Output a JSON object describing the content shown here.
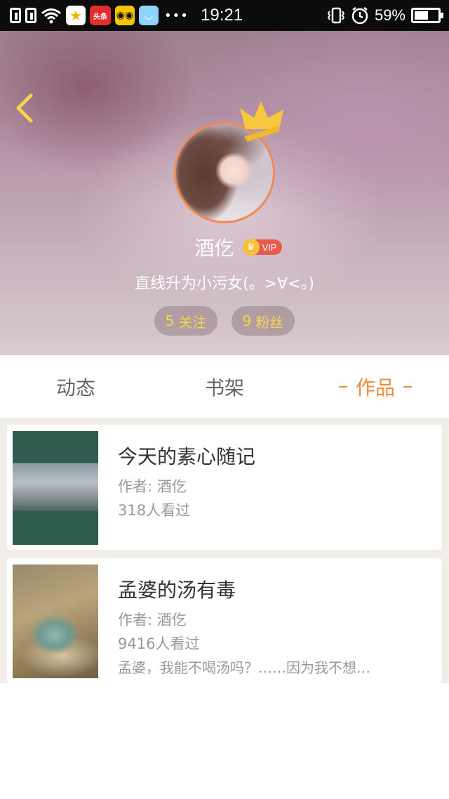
{
  "status_bar": {
    "time": "19:21",
    "battery_percent": "59%",
    "battery_level": 0.59,
    "app_toutiao_label": "头条",
    "more_dots": "•••"
  },
  "profile": {
    "username": "酒仡",
    "vip_label": "VIP",
    "bio": "直线升为小污女(。>∀<。)",
    "follow_count": "5",
    "follow_label": "关注",
    "fans_count": "9",
    "fans_label": "粉丝"
  },
  "tabs": [
    {
      "label": "动态",
      "active": false
    },
    {
      "label": "书架",
      "active": false
    },
    {
      "label": "作品",
      "active": true
    }
  ],
  "works": [
    {
      "title": "今天的素心随记",
      "author": "作者: 酒仡",
      "views": "318人看过",
      "description": ""
    },
    {
      "title": "孟婆的汤有毒",
      "author": "作者: 酒仡",
      "views": "9416人看过",
      "description": "孟婆，我能不喝汤吗？……因为我不想…"
    }
  ],
  "colors": {
    "accent": "#f08a3c",
    "stat_text": "#f5d64a",
    "vip_badge": "#e85a4f"
  }
}
